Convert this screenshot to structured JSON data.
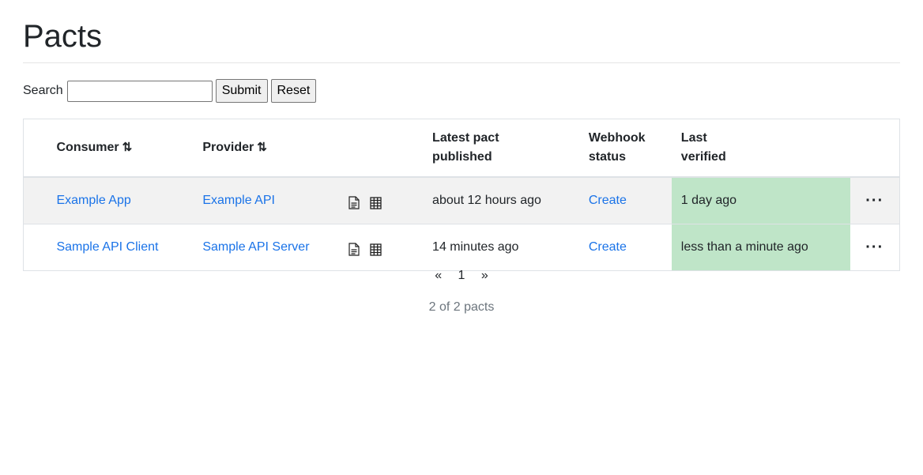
{
  "page": {
    "title": "Pacts"
  },
  "search": {
    "label": "Search",
    "value": "",
    "submit_label": "Submit",
    "reset_label": "Reset"
  },
  "table": {
    "headers": {
      "consumer": "Consumer",
      "provider": "Provider",
      "latest_pact_line1": "Latest pact",
      "latest_pact_line2": "published",
      "webhook_line1": "Webhook",
      "webhook_line2": "status",
      "last_verified_line1": "Last",
      "last_verified_line2": "verified",
      "sort_icon": "⇅"
    },
    "rows": [
      {
        "consumer": "Example App",
        "provider": "Example API",
        "latest_pact_published": "about 12 hours ago",
        "webhook_status": "Create",
        "last_verified": "1 day ago",
        "more": "···"
      },
      {
        "consumer": "Sample API Client",
        "provider": "Sample API Server",
        "latest_pact_published": "14 minutes ago",
        "webhook_status": "Create",
        "last_verified": "less than a minute ago",
        "more": "···"
      }
    ]
  },
  "pagination": {
    "prev": "«",
    "current": "1",
    "next": "»"
  },
  "summary": "2 of 2 pacts",
  "colors": {
    "link": "#1a73e8",
    "verified_bg": "#bfe5c8",
    "stripe_bg": "#f2f2f2"
  },
  "icons": {
    "document": "document-icon",
    "matrix": "matrix-icon",
    "sort": "sort-icon"
  }
}
